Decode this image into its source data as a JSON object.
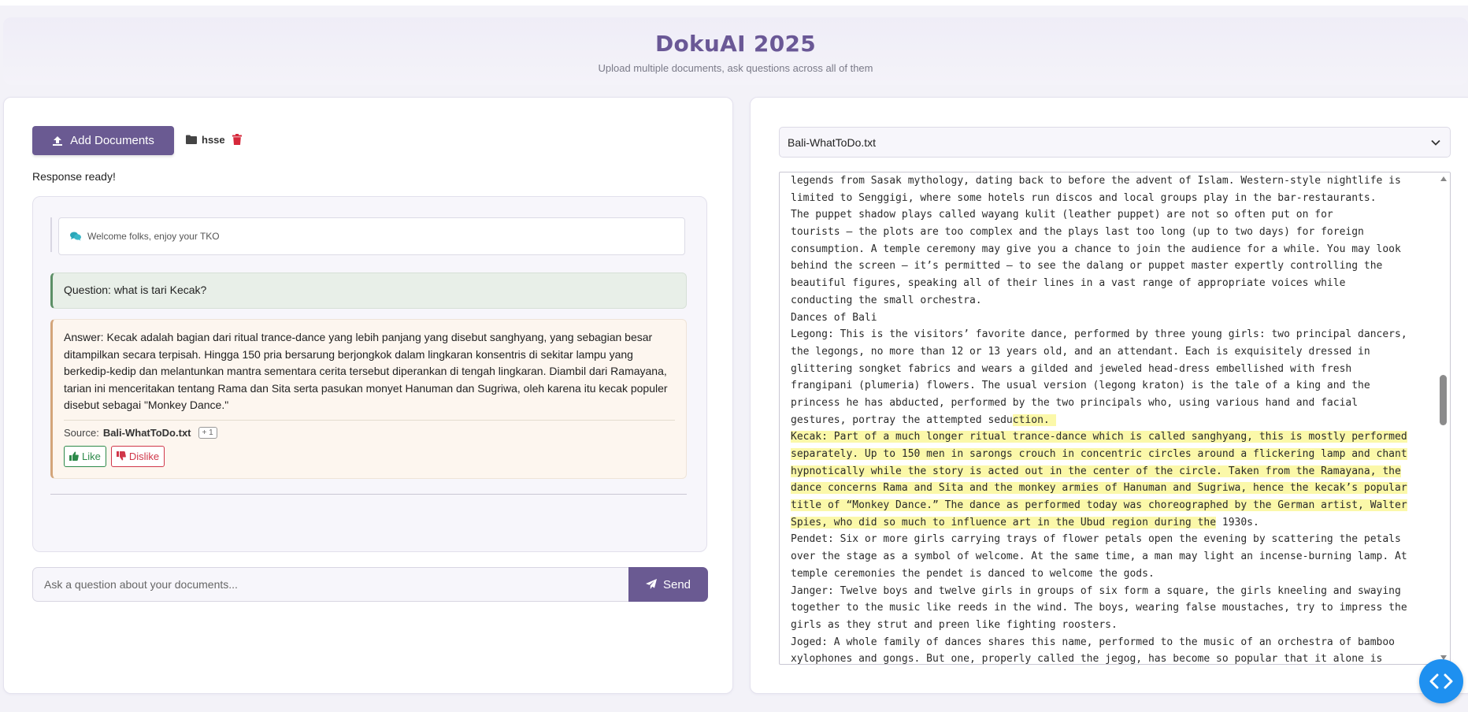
{
  "header": {
    "title": "DokuAI 2025",
    "subtitle": "Upload multiple documents, ask questions across all of them"
  },
  "left": {
    "add_button_label": "Add Documents",
    "folder_name": "hsse",
    "status": "Response ready!",
    "welcome_message": "Welcome folks, enjoy your TKO",
    "question": "Question: what is tari Kecak?",
    "answer": "Answer: Kecak adalah bagian dari ritual trance-dance yang lebih panjang yang disebut sanghyang, yang sebagian besar ditampilkan secara terpisah. Hingga 150 pria bersarung berjongkok dalam lingkaran konsentris di sekitar lampu yang berkedip-kedip dan melantunkan mantra sementara cerita tersebut diperankan di tengah lingkaran. Diambil dari Ramayana, tarian ini menceritakan tentang Rama dan Sita serta pasukan monyet Hanuman dan Sugriwa, oleh karena itu kecak populer disebut sebagai \"Monkey Dance.\"",
    "source_label": "Source:",
    "source_file": "Bali-WhatToDo.txt",
    "source_extra": "+ 1",
    "like_label": "Like",
    "dislike_label": "Dislike",
    "input_placeholder": "Ask a question about your documents...",
    "send_label": "Send"
  },
  "right": {
    "selected_document": "Bali-WhatToDo.txt",
    "lines": [
      {
        "pre": "legends from Sasak mythology, dating back to before the advent of Islam. Western-style nightlife is",
        "hl": "",
        "post": ""
      },
      {
        "pre": "limited to Senggigi, where some hotels run discos and local groups play in the bar-restaurants.",
        "hl": "",
        "post": ""
      },
      {
        "pre": "The puppet shadow plays called wayang kulit (leather puppet) are not so often put on for",
        "hl": "",
        "post": ""
      },
      {
        "pre": "tourists — the plots are too complex and the plays last too long (up to two days) for foreign",
        "hl": "",
        "post": ""
      },
      {
        "pre": "consumption. A temple ceremony may give you a chance to join the audience for a while. You may look",
        "hl": "",
        "post": ""
      },
      {
        "pre": "behind the screen — it’s permitted — to see the dalang or puppet master expertly controlling the",
        "hl": "",
        "post": ""
      },
      {
        "pre": "beautiful figures, speaking all of their lines in a vast range of appropriate voices while",
        "hl": "",
        "post": ""
      },
      {
        "pre": "conducting the small orchestra.",
        "hl": "",
        "post": ""
      },
      {
        "pre": "Dances of Bali",
        "hl": "",
        "post": ""
      },
      {
        "pre": "Legong: This is the visitors’ favorite dance, performed by three young girls: two principal dancers,",
        "hl": "",
        "post": ""
      },
      {
        "pre": "the legongs, no more than 12 or 13 years old, and an attendant. Each is exquisitely dressed in",
        "hl": "",
        "post": ""
      },
      {
        "pre": "glittering songket fabrics and wears a gilded and jeweled head-dress embellished with fresh",
        "hl": "",
        "post": ""
      },
      {
        "pre": "frangipani (plumeria) flowers. The usual version (legong kraton) is the tale of a king and the",
        "hl": "",
        "post": ""
      },
      {
        "pre": "princess he has abducted, performed by the two principals who, using various hand and facial",
        "hl": "",
        "post": ""
      },
      {
        "pre": "gestures, portray the attempted sedu",
        "hl": "ction. ",
        "post": ""
      },
      {
        "pre": "",
        "hl": "Kecak: Part of a much longer ritual trance-dance which is called sanghyang, this is mostly performed",
        "post": ""
      },
      {
        "pre": "",
        "hl": "separately. Up to 150 men in sarongs crouch in concentric circles around a flickering lamp and chant",
        "post": ""
      },
      {
        "pre": "",
        "hl": "hypnotically while the story is acted out in the center of the circle. Taken from the Ramayana, the",
        "post": ""
      },
      {
        "pre": "",
        "hl": "dance concerns Rama and Sita and the monkey armies of Hanuman and Sugriwa, hence the kecak’s popular",
        "post": ""
      },
      {
        "pre": "",
        "hl": "title of “Monkey Dance.” The dance as performed today was choreographed by the German artist, Walter",
        "post": ""
      },
      {
        "pre": "",
        "hl": "Spies, who did so much to influence art in the Ubud region during the",
        "post": " 1930s."
      },
      {
        "pre": "Pendet: Six or more girls carrying trays of flower petals open the evening by scattering the petals",
        "hl": "",
        "post": ""
      },
      {
        "pre": "over the stage as a symbol of welcome. At the same time, a man may light an incense-burning lamp. At",
        "hl": "",
        "post": ""
      },
      {
        "pre": "temple ceremonies the pendet is danced to welcome the gods.",
        "hl": "",
        "post": ""
      },
      {
        "pre": "Janger: Twelve boys and twelve girls in groups of six form a square, the girls kneeling and swaying",
        "hl": "",
        "post": ""
      },
      {
        "pre": "together to the music like reeds in the wind. The boys, wearing false moustaches, try to impress the",
        "hl": "",
        "post": ""
      },
      {
        "pre": "girls as they strut and preen like fighting roosters.",
        "hl": "",
        "post": ""
      },
      {
        "pre": "Joged: A whole family of dances shares this name, performed to the music of an orchestra of bamboo",
        "hl": "",
        "post": ""
      },
      {
        "pre": "xylophones and gongs. But one, properly called the jegog, has become so popular that it alone is",
        "hl": "",
        "post": ""
      }
    ]
  },
  "colors": {
    "accent": "#6a5a92",
    "title": "#6a5896",
    "highlight": "#fbf8a9",
    "like": "#2d8a4a",
    "dislike": "#d0374a",
    "fab": "#1e90f0"
  },
  "icons": {
    "add_button": "upload-icon",
    "folder": "folder-icon",
    "delete": "trash-icon",
    "welcome": "chat-bubbles-icon",
    "like": "thumbs-up-icon",
    "dislike": "thumbs-down-icon",
    "send": "paper-plane-icon",
    "select": "chevron-down-icon",
    "fab": "code-icon"
  }
}
